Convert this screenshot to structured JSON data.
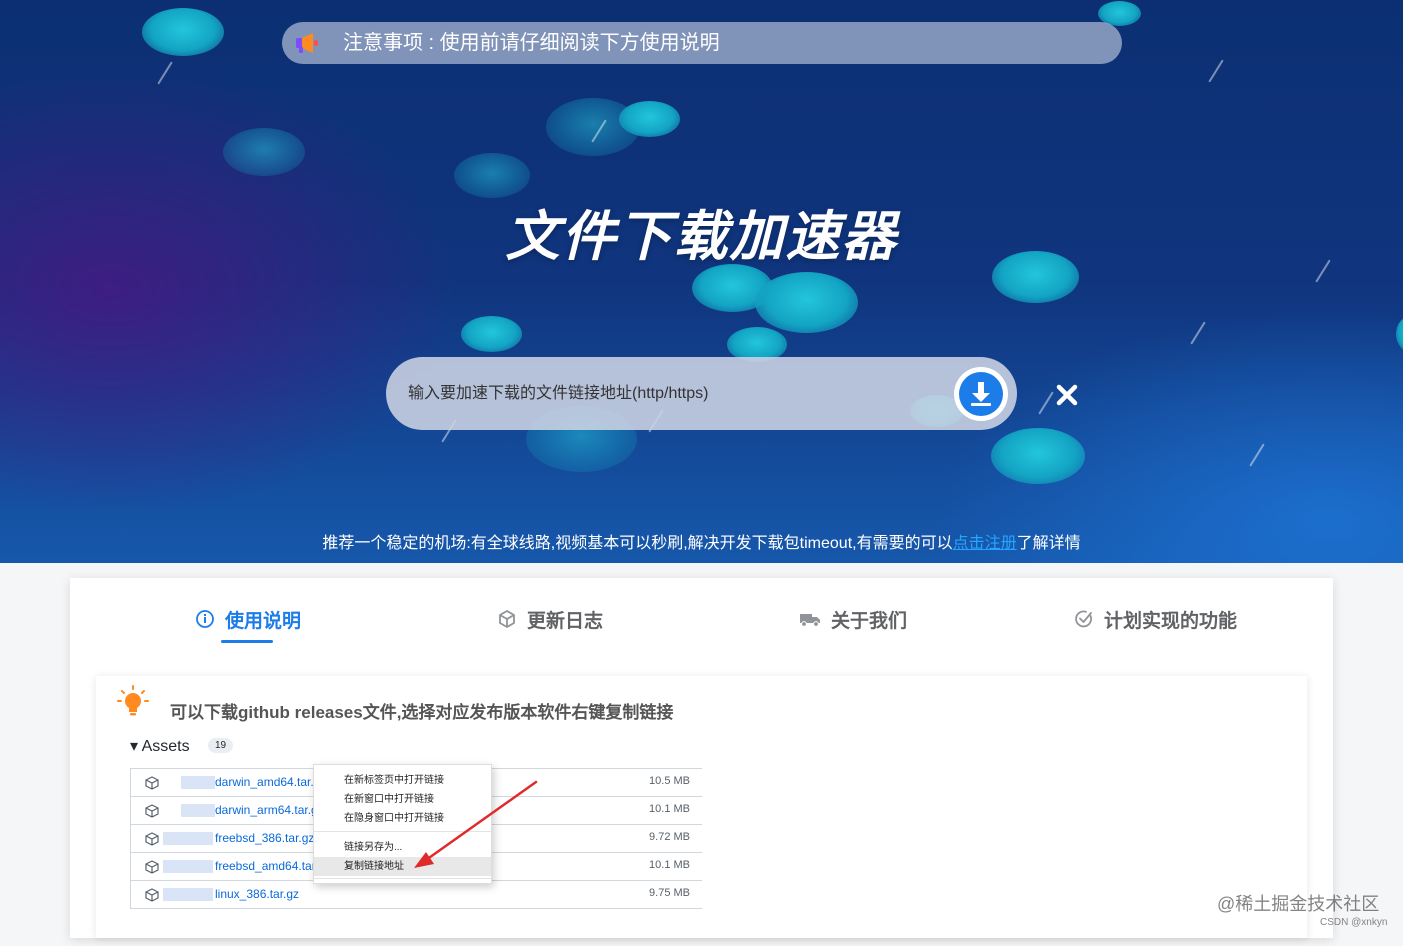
{
  "notice": {
    "icon": "megaphone-icon",
    "text": "注意事项 : 使用前请仔细阅读下方使用说明"
  },
  "hero": {
    "title": "文件下载加速器"
  },
  "search": {
    "placeholder": "输入要加速下载的文件链接地址(http/https)",
    "download_icon": "download-icon",
    "close_icon": "close-icon"
  },
  "promo": {
    "text_before": "推荐一个稳定的机场:有全球线路,视频基本可以秒刷,解决开发下载包timeout,有需要的可以",
    "link_text": "点击注册",
    "text_after": "了解详情"
  },
  "tabs": [
    {
      "label": "使用说明",
      "icon": "info-icon",
      "active": true
    },
    {
      "label": "更新日志",
      "icon": "cube-icon",
      "active": false
    },
    {
      "label": "关于我们",
      "icon": "truck-icon",
      "active": false
    },
    {
      "label": "计划实现的功能",
      "icon": "check-circle-icon",
      "active": false
    }
  ],
  "tip": {
    "icon": "lightbulb-icon",
    "text": "可以下载github releases文件,选择对应发布版本软件右键复制链接"
  },
  "assets": {
    "header": "▾ Assets",
    "count": "19",
    "rows": [
      {
        "name": "darwin_amd64.tar.gz",
        "size": "10.5 MB"
      },
      {
        "name": "darwin_arm64.tar.g",
        "size": "10.1 MB"
      },
      {
        "name": "freebsd_386.tar.gz",
        "size": "9.72 MB"
      },
      {
        "name": "freebsd_amd64.tar",
        "size": "10.1 MB"
      },
      {
        "name": "linux_386.tar.gz",
        "size": "9.75 MB"
      }
    ]
  },
  "context_menu": {
    "items": [
      "在新标签页中打开链接",
      "在新窗口中打开链接",
      "在隐身窗口中打开链接",
      "链接另存为...",
      "复制链接地址"
    ],
    "highlighted": "复制链接地址"
  },
  "watermark": {
    "main": "@稀土掘金技术社区",
    "sub": "CSDN @xnkyn"
  },
  "colors": {
    "accent": "#1d7de8",
    "hero_top": "#0c2f73",
    "hero_bottom": "#1658ab",
    "link": "#27a4ff",
    "arrow": "#e02a2a"
  }
}
